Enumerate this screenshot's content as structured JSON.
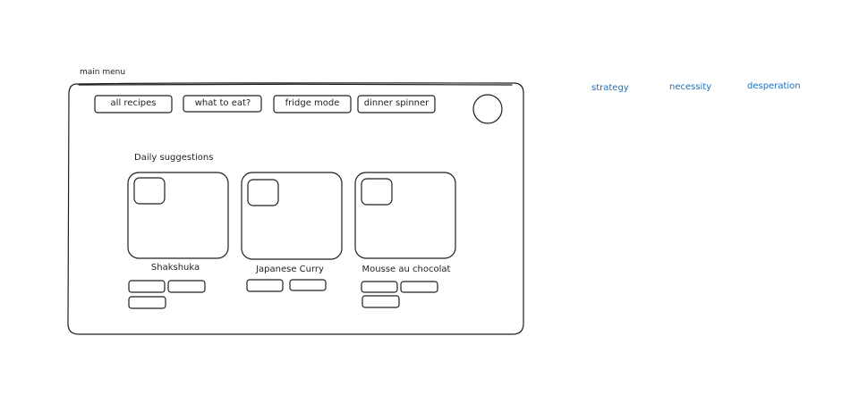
{
  "frame": {
    "label": "main menu"
  },
  "nav": {
    "buttons": [
      {
        "label": "all recipes"
      },
      {
        "label": "what to eat?"
      },
      {
        "label": "fridge mode"
      },
      {
        "label": "dinner spinner"
      }
    ]
  },
  "suggestions": {
    "heading": "Daily suggestions",
    "cards": [
      {
        "title": "Shakshuka",
        "tag_count": 3
      },
      {
        "title": "Japanese Curry",
        "tag_count": 2
      },
      {
        "title": "Mousse au chocolat",
        "tag_count": 3
      }
    ]
  },
  "side_notes": [
    "strategy",
    "necessity",
    "desperation"
  ],
  "colors": {
    "stroke": "#1e1e1e",
    "note": "#1971c2",
    "background": "#ffffff"
  }
}
